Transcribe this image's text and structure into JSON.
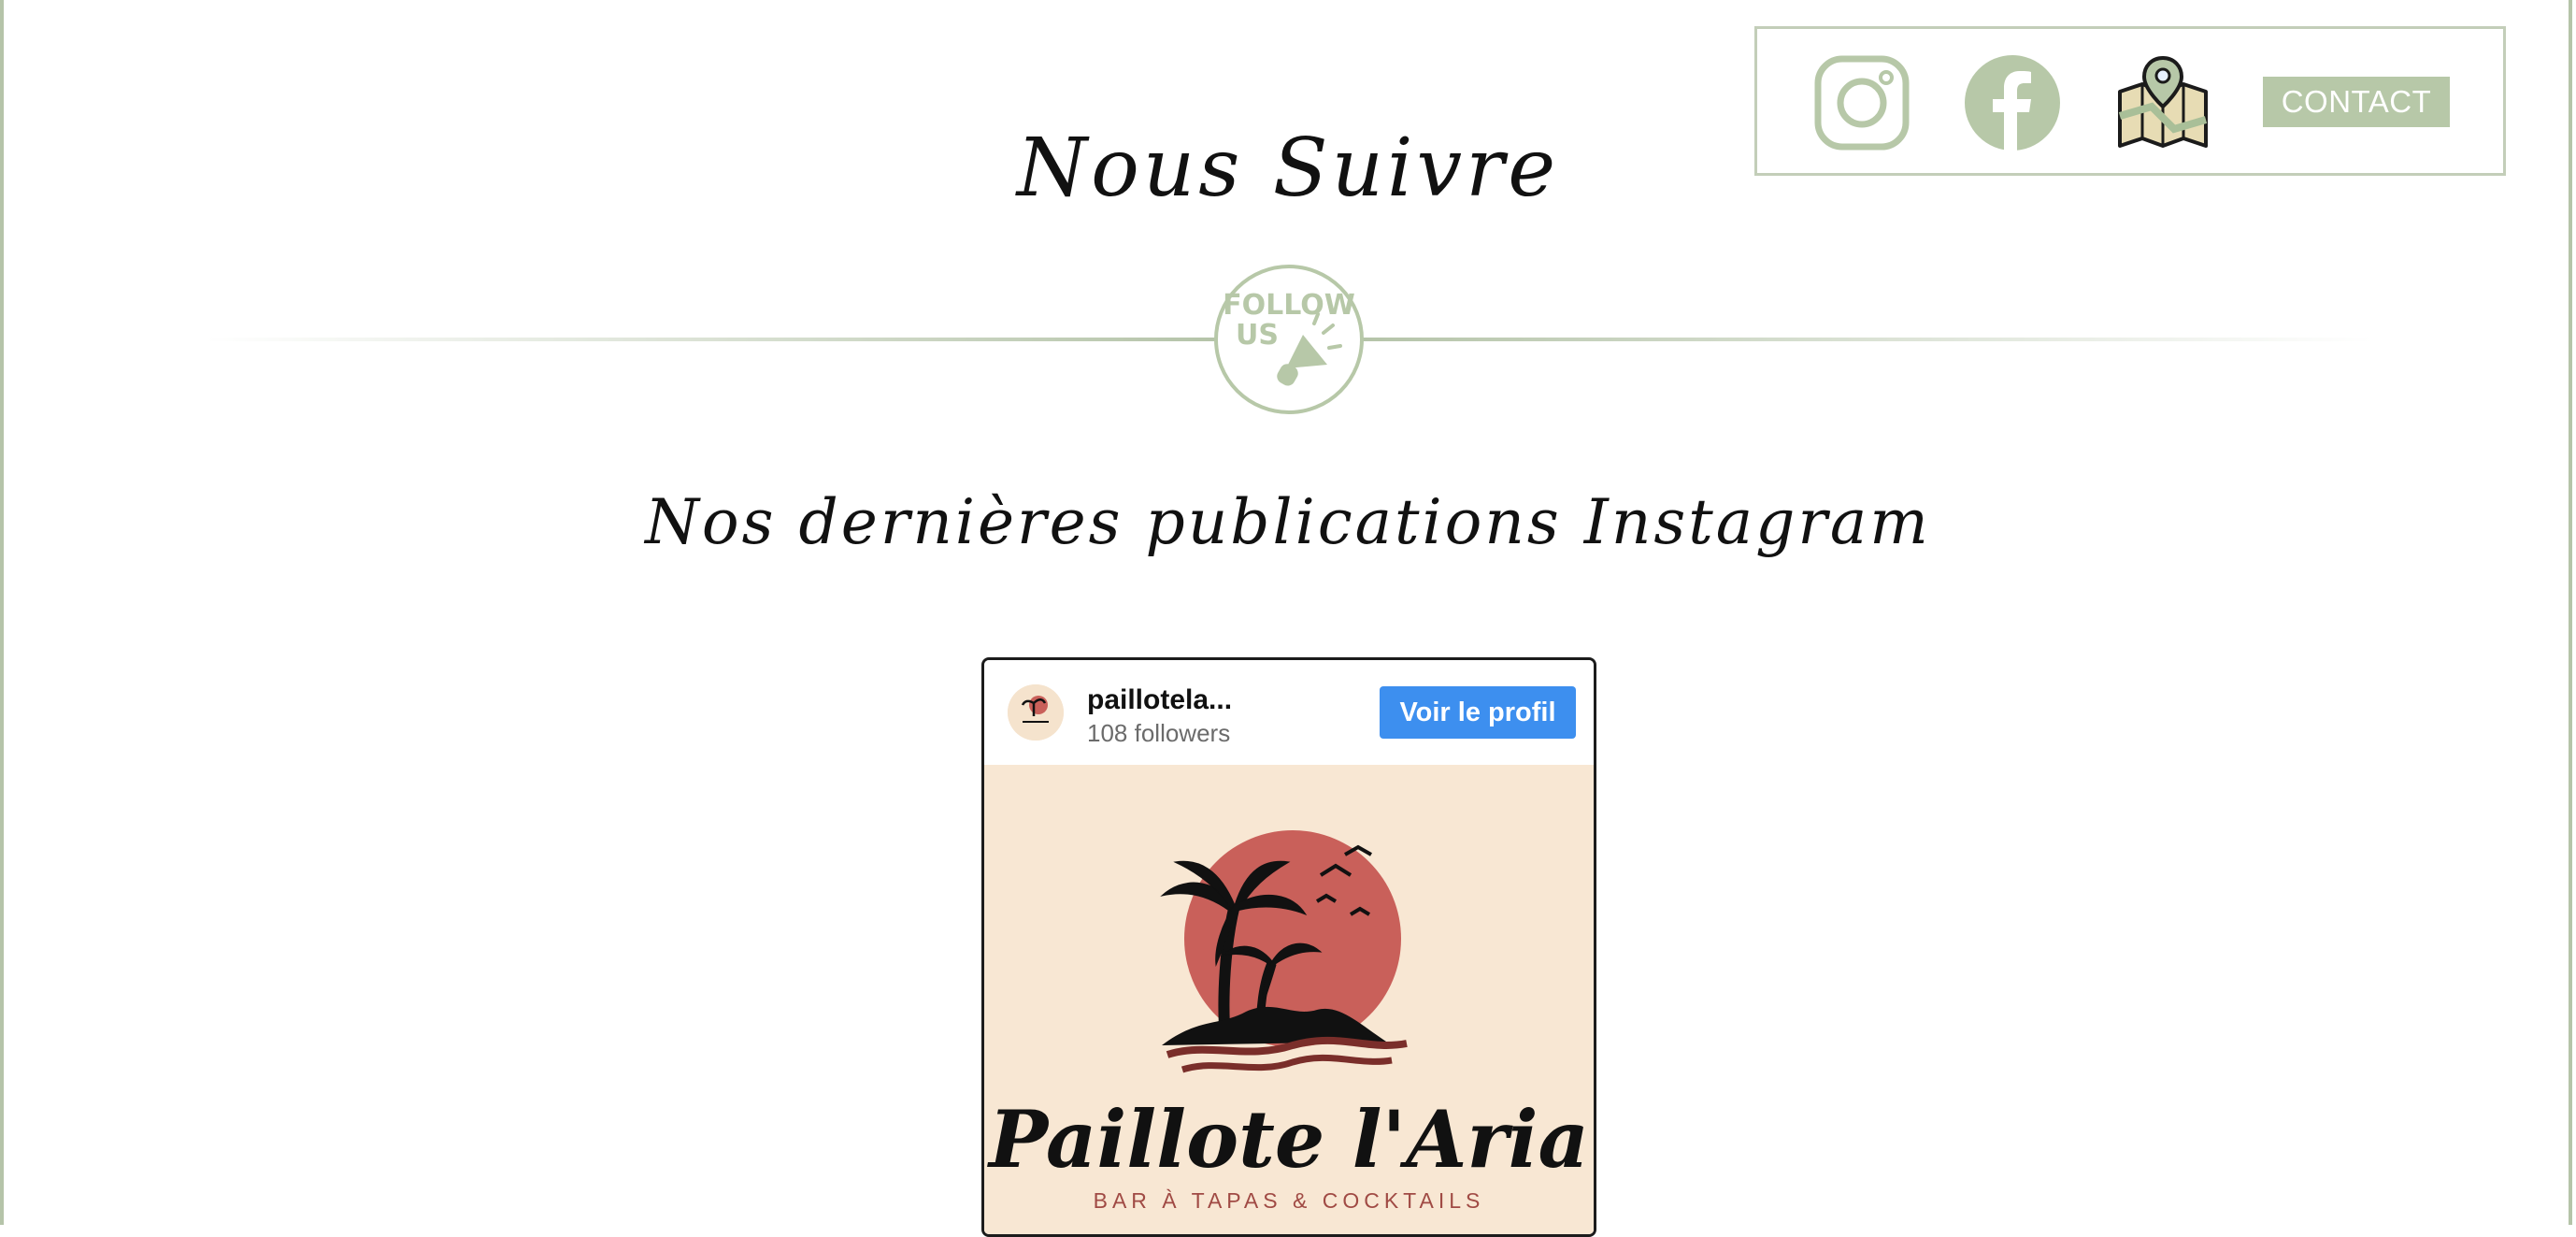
{
  "social": {
    "instagram_icon": "instagram-icon",
    "facebook_icon": "facebook-icon",
    "map_icon": "map-location-icon",
    "contact_label": "CONTACT"
  },
  "follow": {
    "title": "Nous Suivre",
    "badge_line1": "FOLLOW",
    "badge_line2": "US",
    "subtitle": "Nos dernières publications Instagram"
  },
  "instagram_widget": {
    "username": "paillotela...",
    "followers": "108 followers",
    "profile_button": "Voir le profil",
    "post": {
      "logo_title": "Paillote l'Aria",
      "logo_tagline": "BAR À TAPAS & COCKTAILS"
    }
  },
  "colors": {
    "accent_green": "#b7c8a8",
    "frame_green": "#b5c4a9",
    "instagram_button": "#3d8fef",
    "post_background": "#f8e7d3",
    "sun_red": "#c9605a"
  }
}
